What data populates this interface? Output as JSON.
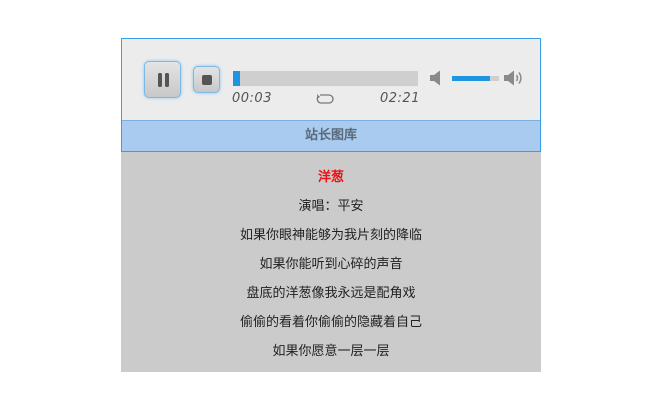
{
  "player": {
    "controls": {
      "pause_icon": "pause-icon",
      "stop_icon": "stop-icon"
    },
    "progress": {
      "current_time": "00:03",
      "total_time": "02:21",
      "fraction": 0.021
    },
    "repeat_icon": "repeat-icon",
    "volume": {
      "level": 0.8,
      "mute_icon": "speaker-mute-icon",
      "max_icon": "speaker-max-icon"
    },
    "title": "站长图库",
    "colors": {
      "accent": "#1f95e0",
      "title_bar": "#a8cbef",
      "song_title": "#ee1111"
    }
  },
  "lyrics": {
    "song_title": "洋葱",
    "lines": [
      "演唱：平安",
      "如果你眼神能够为我片刻的降临",
      "如果你能听到心碎的声音",
      "盘底的洋葱像我永远是配角戏",
      "偷偷的看着你偷偷的隐藏着自己",
      "如果你愿意一层一层"
    ]
  }
}
